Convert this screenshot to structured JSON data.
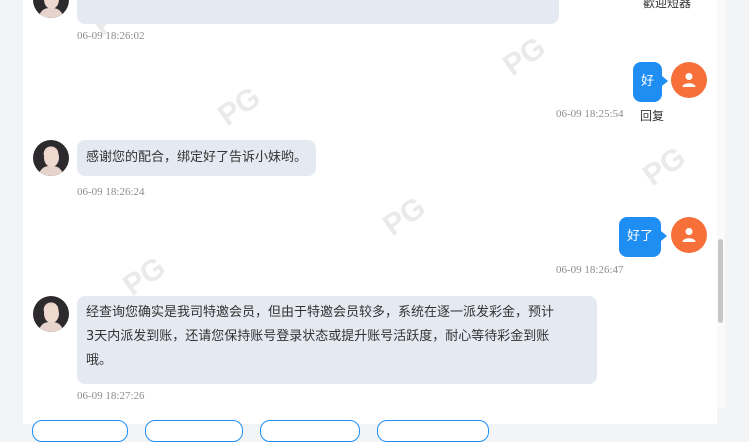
{
  "header": {
    "corner_text": "歡迎短器"
  },
  "messages": [
    {
      "id": "m0",
      "side": "left",
      "text": "",
      "time": "06-09 18:26:02"
    },
    {
      "id": "m1",
      "side": "right",
      "text": "好",
      "time": "06-09 18:25:54",
      "reply": "回复"
    },
    {
      "id": "m2",
      "side": "left",
      "text": "感谢您的配合，绑定好了告诉小妹哟。",
      "time": "06-09 18:26:24"
    },
    {
      "id": "m3",
      "side": "right",
      "text": "好了",
      "time": "06-09 18:26:47"
    },
    {
      "id": "m4",
      "side": "left",
      "lines": [
        "经查询您确实是我司特邀会员，但由于特邀会员较多，系统在逐一派发彩金，预计",
        "3天内派发到账，还请您保持账号登录状态或提升账号活跃度，耐心等待彩金到账",
        "哦。"
      ],
      "time": "06-09 18:27:26"
    }
  ],
  "watermark": "PG",
  "colors": {
    "accent": "#1e8ef3",
    "user_avatar": "#f7703a",
    "bubble_left": "#e5e9f2"
  },
  "icons": {
    "user_avatar": "person-icon"
  }
}
